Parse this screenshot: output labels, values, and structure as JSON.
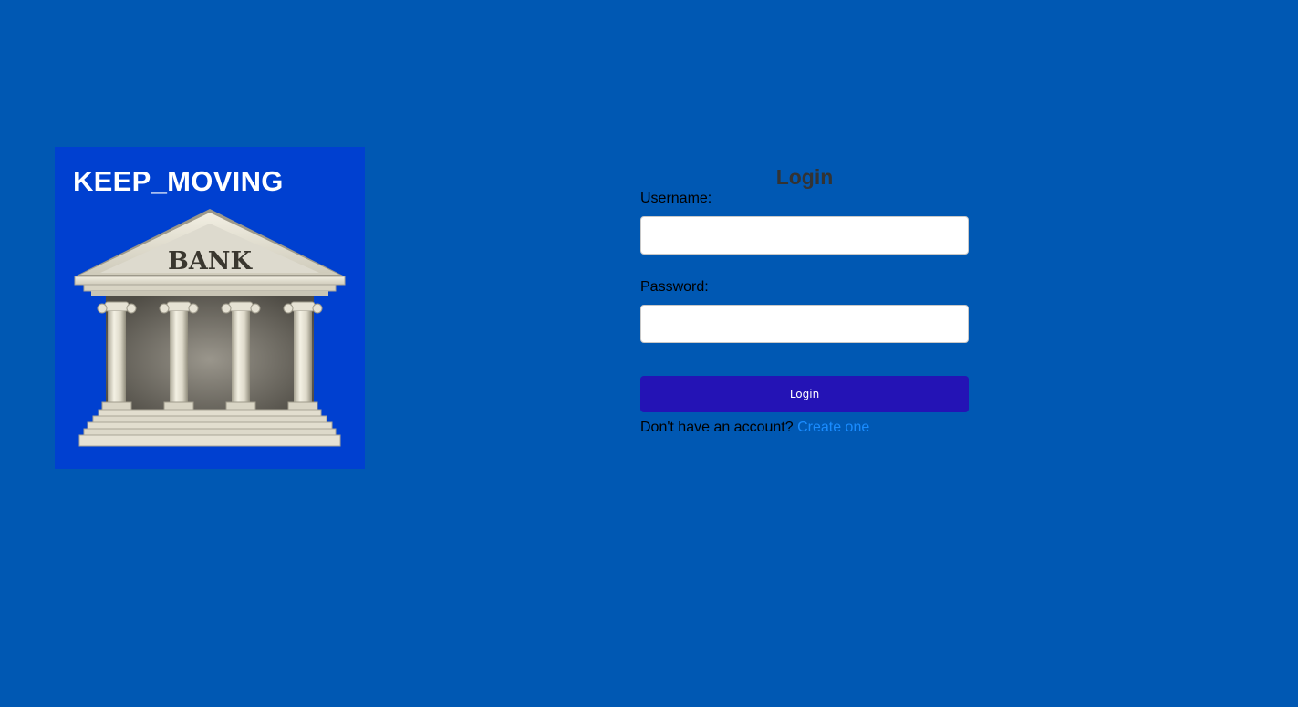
{
  "brand": {
    "title": "KEEP_MOVING",
    "illustration_text": "BANK",
    "panel_color": "#0040d0"
  },
  "page": {
    "background_color": "#0058b3"
  },
  "login": {
    "heading": "Login",
    "username_label": "Username:",
    "username_value": "",
    "password_label": "Password:",
    "password_value": "",
    "button_label": "Login",
    "button_color": "#2413b5",
    "signup_prompt": "Don't have an account?",
    "signup_link": "Create one",
    "link_color": "#1a8cff"
  },
  "icons": {
    "logo": "bank-building-icon"
  }
}
